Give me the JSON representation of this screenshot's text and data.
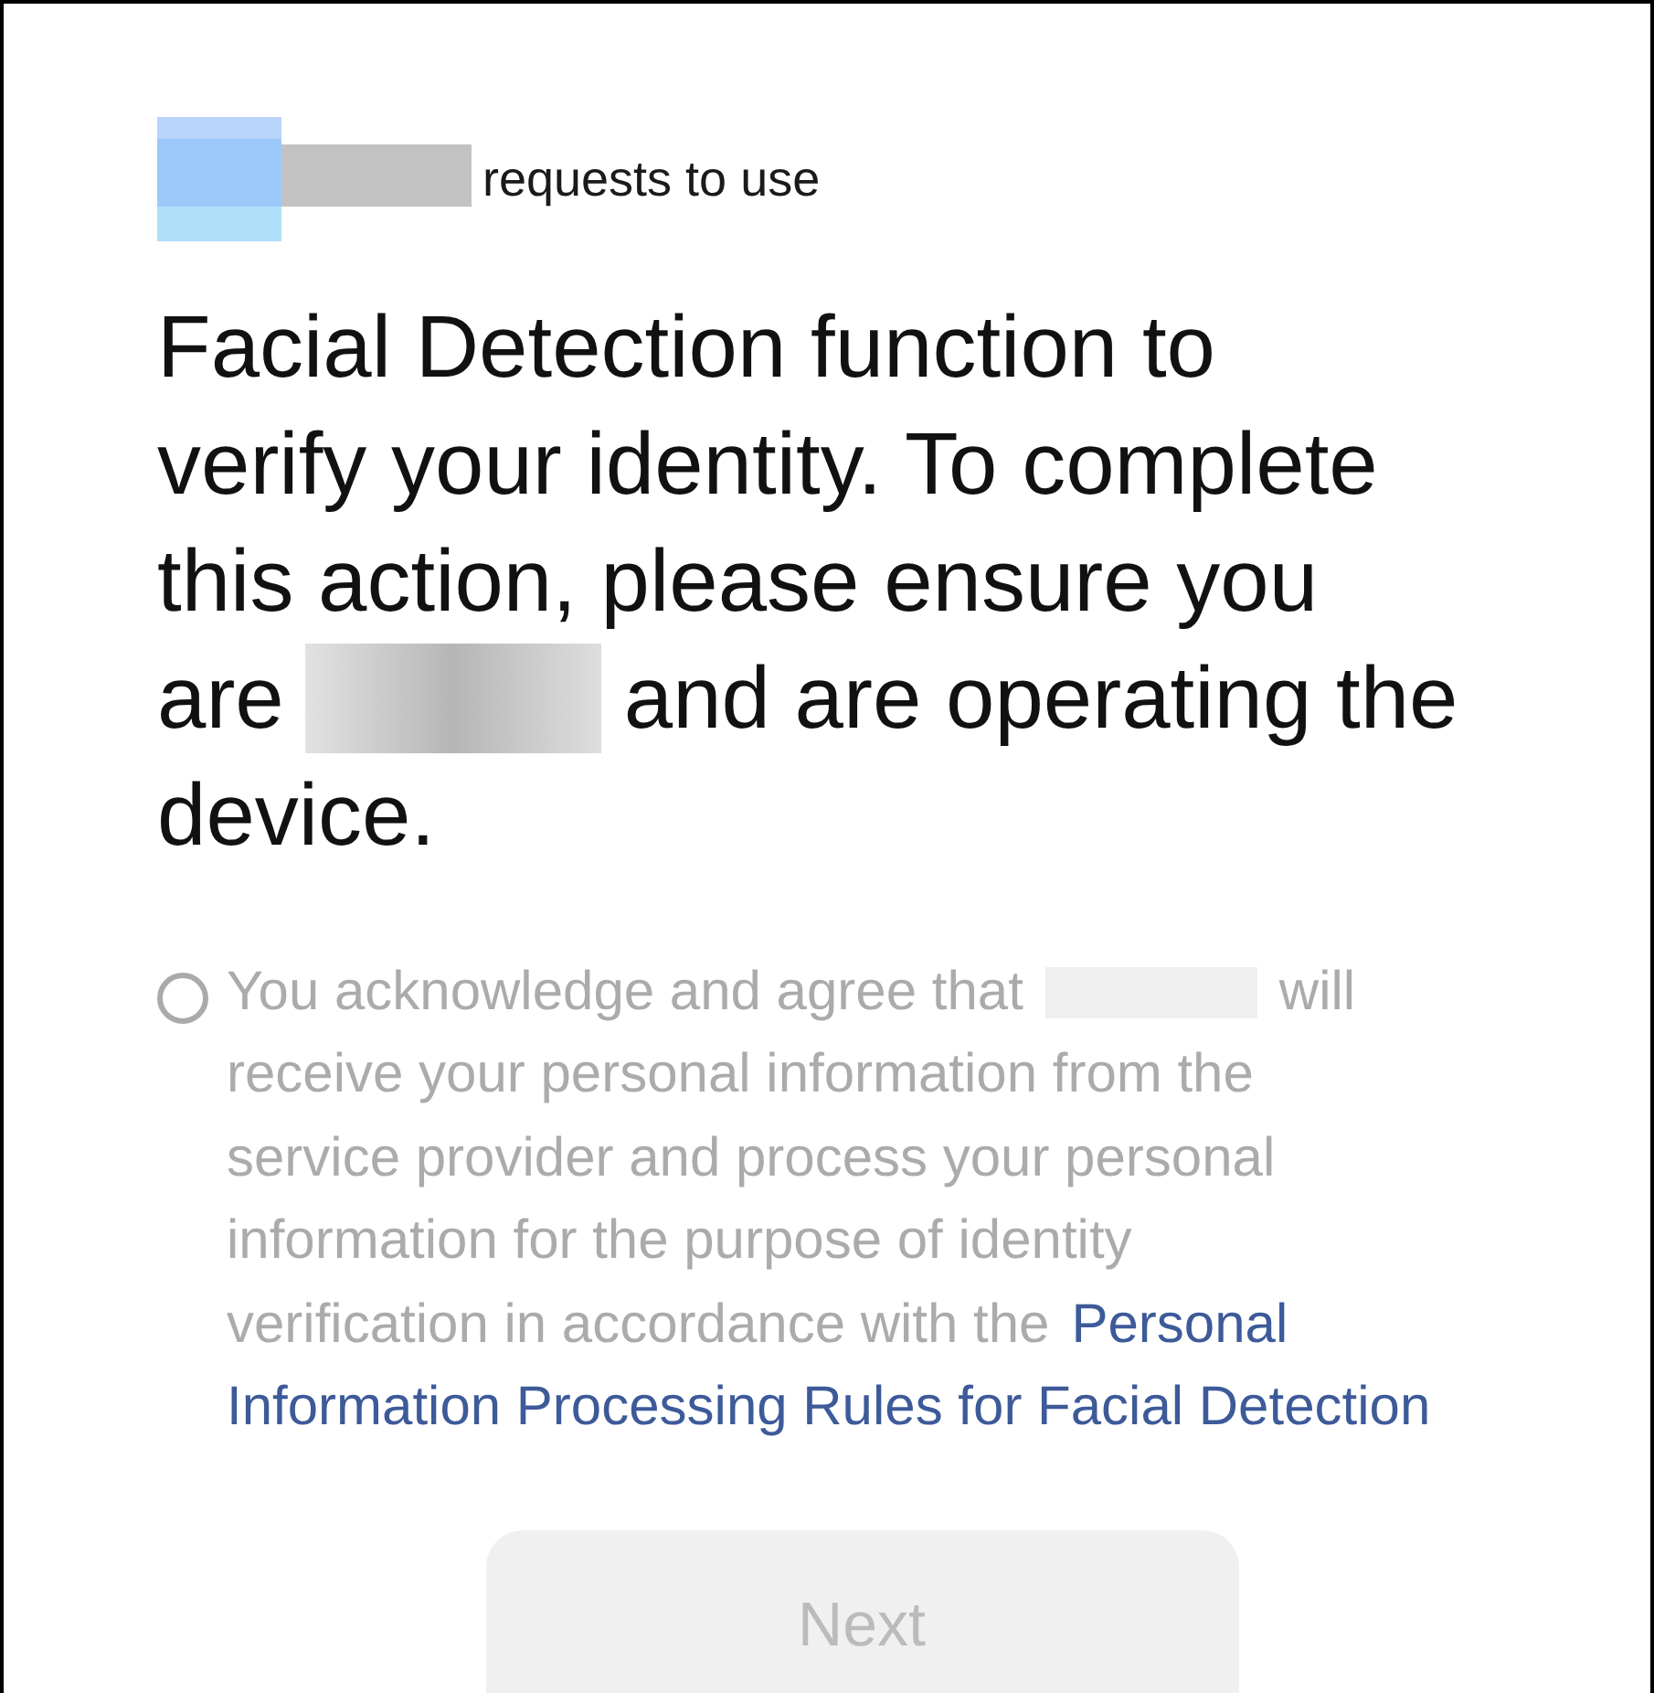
{
  "request": {
    "text": "requests to use"
  },
  "heading": {
    "lines": [
      [
        {
          "kind": "text",
          "text": "Facial Detection function to"
        }
      ],
      [
        {
          "kind": "text",
          "text": "verify your identity. To complete"
        }
      ],
      [
        {
          "kind": "text",
          "text": "this action, please ensure you"
        }
      ],
      [
        {
          "kind": "text",
          "text": "are"
        },
        {
          "kind": "redacted"
        },
        {
          "kind": "text",
          "text": "and are operating the"
        }
      ],
      [
        {
          "kind": "text",
          "text": "device."
        }
      ]
    ]
  },
  "consent": {
    "checked": false,
    "lines": [
      [
        {
          "kind": "text",
          "text": "You acknowledge and agree that"
        },
        {
          "kind": "redacted"
        },
        {
          "kind": "text",
          "text": "will"
        }
      ],
      [
        {
          "kind": "text",
          "text": "receive your personal information from the"
        }
      ],
      [
        {
          "kind": "text",
          "text": "service provider and process your personal"
        }
      ],
      [
        {
          "kind": "text",
          "text": "information for the purpose of identity"
        }
      ],
      [
        {
          "kind": "text",
          "text": "verification in accordance with the"
        },
        {
          "kind": "link",
          "text": "Personal"
        }
      ],
      [
        {
          "kind": "link",
          "text": "Information Processing Rules for Facial Detection"
        }
      ]
    ]
  },
  "next_button": {
    "label": "Next",
    "disabled": true
  }
}
